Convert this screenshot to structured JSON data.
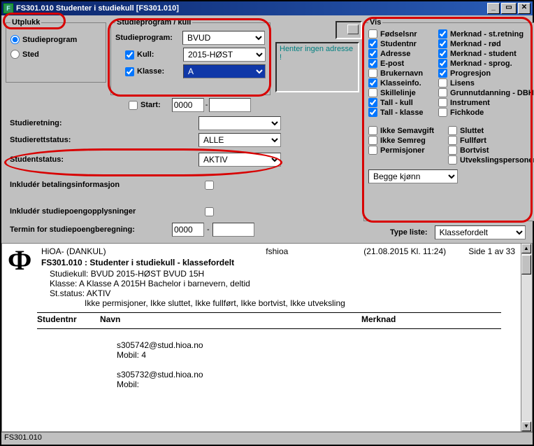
{
  "window": {
    "title": "FS301.010 Studenter i studiekull  [FS301.010]"
  },
  "utplukk": {
    "legend": "Utplukk",
    "opt_program": "Studieprogram",
    "opt_sted": "Sted"
  },
  "spkull": {
    "legend": "Studieprogram / kull",
    "program_label": "Studieprogram:",
    "program_value": "BVUD",
    "kull_label": "Kull:",
    "kull_value": "2015-HØST",
    "klasse_label": "Klasse:",
    "klasse_value": "A"
  },
  "addr_box": "Henter ingen adresse !",
  "filters": {
    "start_label": "Start:",
    "start_value": "0000",
    "studieretning_label": "Studieretning:",
    "studieretning_value": "",
    "studierettstatus_label": "Studierettstatus:",
    "studierettstatus_value": "ALLE",
    "studentstatus_label": "Studentstatus:",
    "studentstatus_value": "AKTIV",
    "betaling_label": "Inkludér betalingsinformasjon",
    "studiepoeng_label": "Inkludér studiepoengopplysninger",
    "termin_label": "Termin for studiepoengberegning:",
    "termin_value": "0000"
  },
  "vis": {
    "legend": "Vis",
    "col1": [
      {
        "label": "Fødselsnr",
        "checked": false
      },
      {
        "label": "Studentnr",
        "checked": true
      },
      {
        "label": "Adresse",
        "checked": true
      },
      {
        "label": "E-post",
        "checked": true
      },
      {
        "label": "Brukernavn",
        "checked": false
      },
      {
        "label": "Klasseinfo.",
        "checked": true
      },
      {
        "label": "Skillelinje",
        "checked": false
      },
      {
        "label": "Tall - kull",
        "checked": true
      },
      {
        "label": "Tall - klasse",
        "checked": true
      }
    ],
    "col2": [
      {
        "label": "Merknad - st.retning",
        "checked": true
      },
      {
        "label": "Merknad - rød",
        "checked": true
      },
      {
        "label": "Merknad - student",
        "checked": true
      },
      {
        "label": "Merknad - sprog.",
        "checked": true
      },
      {
        "label": "Progresjon",
        "checked": true
      },
      {
        "label": "Lisens",
        "checked": false
      },
      {
        "label": "Grunnutdanning - DBH",
        "checked": false
      },
      {
        "label": "Instrument",
        "checked": false
      },
      {
        "label": "Fichkode",
        "checked": false
      }
    ],
    "col1b": [
      {
        "label": "Ikke Semavgift",
        "checked": false
      },
      {
        "label": "Ikke Semreg",
        "checked": false
      },
      {
        "label": "Permisjoner",
        "checked": false
      }
    ],
    "col2b": [
      {
        "label": "Sluttet",
        "checked": false
      },
      {
        "label": "Fullført",
        "checked": false
      },
      {
        "label": "Bortvist",
        "checked": false
      },
      {
        "label": "Utvekslingspersoner",
        "checked": false
      }
    ],
    "kjonn_value": "Begge kjønn",
    "type_liste_label": "Type liste:",
    "type_liste_value": "Klassefordelt"
  },
  "report": {
    "org": "HiOA- (DANKUL)",
    "sys": "fshioa",
    "datetime": "(21.08.2015 Kl. 11:24)",
    "page": "Side 1 av 33",
    "heading": "FS301.010 : Studenter i studiekull - klassefordelt",
    "line_kull": "Studiekull: BVUD 2015-HØST BVUD 15H",
    "line_klasse": "Klasse:      A Klasse A 2015H Bachelor i barnevern, deltid",
    "line_status": "St.status: AKTIV",
    "line_filter": "Ikke permisjoner, Ikke sluttet, Ikke fullført, Ikke bortvist, Ikke utveksling",
    "col_studentnr": "Studentnr",
    "col_navn": "Navn",
    "col_merknad": "Merknad",
    "rows": [
      {
        "epost": "s305742@stud.hioa.no",
        "mobil": "Mobil:  4"
      },
      {
        "epost": "s305732@stud.hioa.no",
        "mobil": "Mobil:  "
      }
    ]
  },
  "status": "FS301.010"
}
